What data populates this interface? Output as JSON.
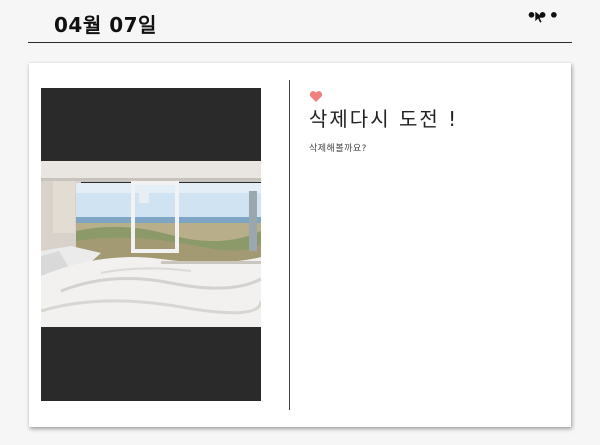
{
  "header": {
    "date": "04월 07일",
    "more_label": "•••"
  },
  "card": {
    "title": "삭제다시 도전 !",
    "description": "삭제해볼까요?",
    "heart_color": "#f08080",
    "photo_alt": "camper van bed view of beach"
  },
  "colors": {
    "background": "#f6f6f6",
    "card": "#ffffff",
    "photo_frame": "#2a2a2a"
  }
}
